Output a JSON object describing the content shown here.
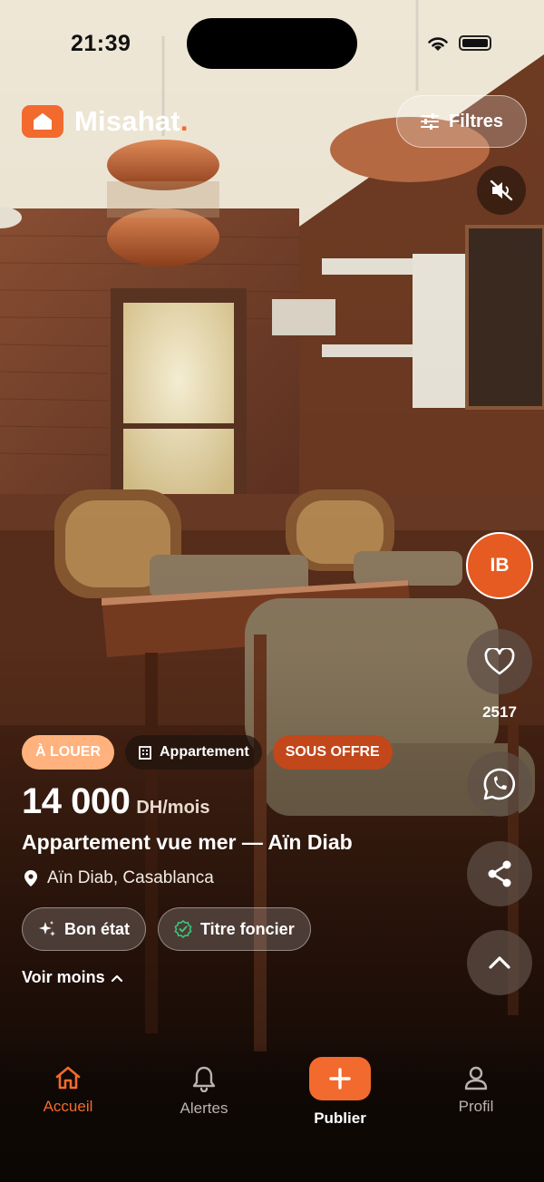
{
  "status_bar": {
    "time": "21:39"
  },
  "header": {
    "brand": "Misahat",
    "brand_dot": ".",
    "filters_label": "Filtres"
  },
  "rail": {
    "avatar_initials": "IB",
    "like_count": "2517"
  },
  "listing": {
    "tags": {
      "rent": "À LOUER",
      "type": "Appartement",
      "status": "SOUS OFFRE"
    },
    "price": "14 000",
    "price_unit": "DH/mois",
    "title": "Appartement vue mer — Aïn Diab",
    "location": "Aïn Diab, Casablanca",
    "features": [
      "Bon état",
      "Titre foncier"
    ],
    "see_less": "Voir moins"
  },
  "nav": {
    "home": "Accueil",
    "alerts": "Alertes",
    "publish": "Publier",
    "profile": "Profil"
  },
  "colors": {
    "accent": "#f26a2e",
    "offer": "#c2471a",
    "rent_tag": "#ffb27d"
  }
}
